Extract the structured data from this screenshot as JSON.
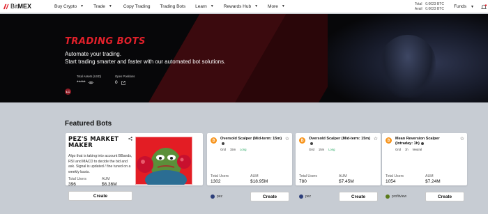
{
  "nav": {
    "logo_a": "Bit",
    "logo_b": "MEX",
    "items": [
      {
        "label": "Buy Crypto",
        "caret": true
      },
      {
        "label": "Trade",
        "caret": true
      },
      {
        "label": "Copy Trading",
        "caret": false
      },
      {
        "label": "Trading Bots",
        "caret": false
      },
      {
        "label": "Learn",
        "caret": true
      },
      {
        "label": "Rewards Hub",
        "caret": true
      },
      {
        "label": "More",
        "caret": true
      }
    ],
    "total_label": "Total",
    "total_value": "0.0023 BTC",
    "avail_label": "Avail",
    "avail_value": "0.0023 BTC",
    "funds": "Funds"
  },
  "hero": {
    "title": "TRADING BOTS",
    "tagline1": "Automate your trading.",
    "tagline2": "Start trading smarter and faster with our automated bot solutions.",
    "avatar": "LC",
    "assets_label": "Total Assets (USD)",
    "assets_value": "*****",
    "positions_label": "Open Positions",
    "positions_value": "0"
  },
  "section_title": "Featured Bots",
  "featured": {
    "title_l1": "PEZ'S MARKET",
    "title_l2": "MAKER",
    "desc": "Algo that is taking into account BBands, RSI and MACD to decide the bid and ask. Signal is updated / fine tuned on a weekly basis.",
    "users_label": "Total Users",
    "users_value": "396",
    "aum_label": "AUM",
    "aum_value": "$6.36M",
    "button": "Create"
  },
  "bots": [
    {
      "title": "Oversold Scalper (Mid-term: 15m)",
      "tags": [
        "Grid",
        "15m",
        "Long"
      ],
      "users_label": "Total Users",
      "users": "1302",
      "aum_label": "AUM",
      "aum": "$18.95M",
      "creator": "pez",
      "button": "Create"
    },
    {
      "title": "Oversold Scalper (Mid-term: 15m)",
      "tags": [
        "Grid",
        "15m",
        "Long"
      ],
      "users_label": "Total Users",
      "users": "780",
      "aum_label": "AUM",
      "aum": "$7.45M",
      "creator": "pez",
      "button": "Create"
    },
    {
      "title": "Mean Reversion Scalper (Intraday: 1h)",
      "tags": [
        "Grid",
        "1h",
        "Neutral"
      ],
      "users_label": "Total Users",
      "users": "1054",
      "aum_label": "AUM",
      "aum": "$7.24M",
      "creator": "profitview",
      "button": "Create"
    }
  ],
  "colors": {
    "brand_red": "#e2202a",
    "long_green": "#1fa35c",
    "btc_orange": "#f7931a"
  }
}
